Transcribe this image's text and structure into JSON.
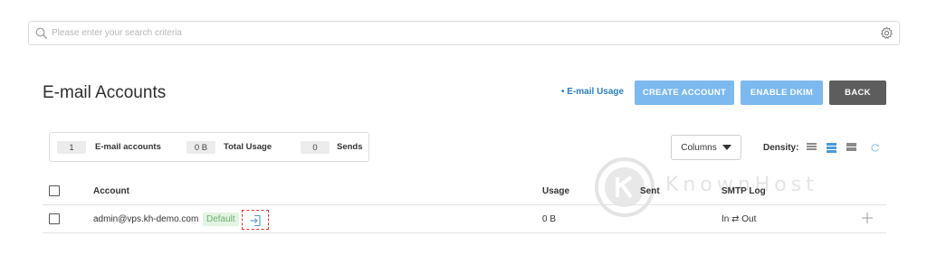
{
  "search": {
    "placeholder": "Please enter your search criteria",
    "value": ""
  },
  "header": {
    "title": "E-mail Accounts",
    "usage_link": "• E-mail Usage",
    "buttons": {
      "create": "CREATE ACCOUNT",
      "dkim": "ENABLE DKIM",
      "back": "BACK"
    }
  },
  "stats": [
    {
      "value": "1",
      "label": "E-mail accounts"
    },
    {
      "value": "0 B",
      "label": "Total Usage"
    },
    {
      "value": "0",
      "label": "Sends"
    }
  ],
  "toolbar": {
    "columns_label": "Columns",
    "density_label": "Density:",
    "density_selected": "medium"
  },
  "table": {
    "headers": [
      "Account",
      "Usage",
      "Sent",
      "SMTP Log"
    ],
    "rows": [
      {
        "account": "admin@vps.kh-demo.com",
        "badge": "Default",
        "usage": "0 B",
        "sent": "",
        "smtp_log": "In ⇄ Out"
      }
    ]
  },
  "watermark": {
    "text": "KnownHost"
  },
  "colors": {
    "primary_button": "#7cb9ee",
    "back_button": "#5d5d5d",
    "link": "#2b7ec1",
    "badge_bg": "#e3f4e3",
    "badge_text": "#6fae6f",
    "highlight_border": "#e03030"
  },
  "icons": [
    "search-icon",
    "gear-icon",
    "caret-down-icon",
    "density-compact-icon",
    "density-medium-icon",
    "density-large-icon",
    "refresh-icon",
    "login-icon",
    "plus-icon",
    "knownhost-logo"
  ]
}
